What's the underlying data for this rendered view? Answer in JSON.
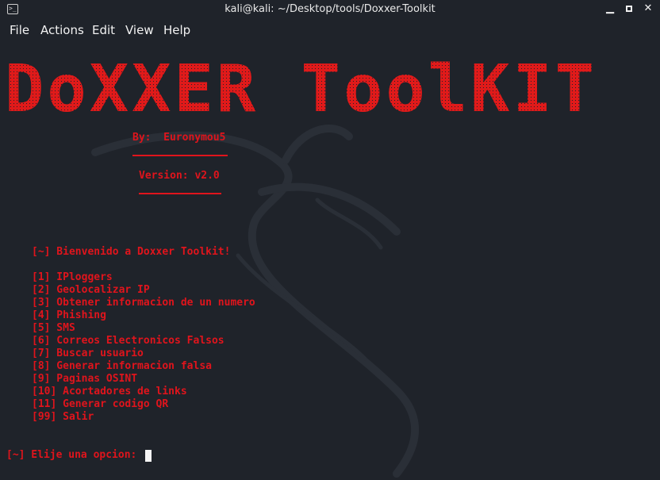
{
  "window": {
    "title": "kali@kali: ~/Desktop/tools/Doxxer-Toolkit",
    "terminal_icon": "terminal-icon",
    "buttons": [
      "minimize-icon",
      "maximize-icon",
      "close-icon"
    ],
    "close_label": "✕",
    "minimize_label": "▁"
  },
  "menu": {
    "file": "File",
    "actions": "Actions",
    "edit": "Edit",
    "view": "View",
    "help": "Help"
  },
  "terminal": {
    "banner": "DoXXER ToolKIT",
    "by": "By:  Euronymou5",
    "version": "Version: v2.0",
    "welcome": "[~] Bienvenido a Doxxer Toolkit!",
    "options": [
      "[1] IPloggers",
      "[2] Geolocalizar IP",
      "[3] Obtener informacion de un numero",
      "[4] Phishing",
      "[5] SMS",
      "[6] Correos Electronicos Falsos",
      "[7] Buscar usuario",
      "[8] Generar informacion falsa",
      "[9] Paginas OSINT",
      "[10] Acortadores de links",
      "[11] Generar codigo QR",
      "[99] Salir"
    ],
    "prompt": "[~] Elije una opcion: "
  },
  "colors": {
    "background": "#1f232a",
    "text_red": "#e0141c",
    "menu_text": "#f2f2f2"
  }
}
